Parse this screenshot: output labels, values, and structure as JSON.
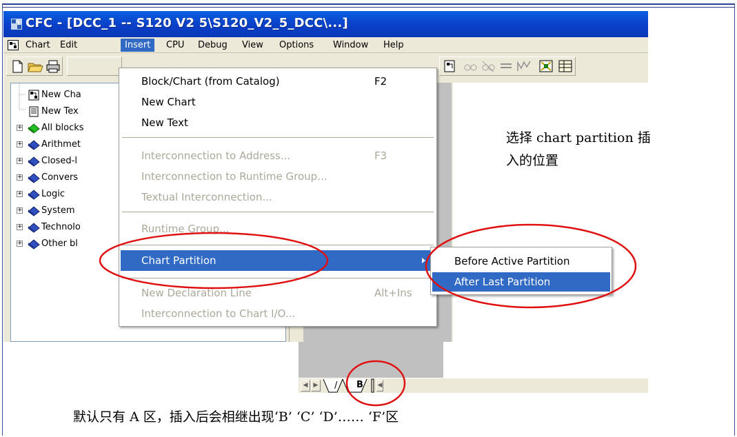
{
  "window": {
    "title": "CFC - [DCC_1 -- S120 V2 5\\S120_V2_5_DCC\\...]"
  },
  "menubar": {
    "items": [
      "Chart",
      "Edit",
      "Insert",
      "CPU",
      "Debug",
      "View",
      "Options",
      "Window",
      "Help"
    ],
    "active": "Insert"
  },
  "tree": {
    "items": [
      {
        "label": "New Cha",
        "icon": "chart-icon",
        "expandable": false
      },
      {
        "label": "New Tex",
        "icon": "text-doc-icon",
        "expandable": false
      },
      {
        "label": "All blocks",
        "icon": "green-book-icon",
        "expandable": true
      },
      {
        "label": "Arithmet",
        "icon": "blue-book-icon",
        "expandable": true
      },
      {
        "label": "Closed-l",
        "icon": "blue-book-icon",
        "expandable": true
      },
      {
        "label": "Convers",
        "icon": "blue-book-icon",
        "expandable": true
      },
      {
        "label": "Logic",
        "icon": "blue-book-icon",
        "expandable": true
      },
      {
        "label": "System",
        "icon": "blue-book-icon",
        "expandable": true
      },
      {
        "label": "Technolo",
        "icon": "blue-book-icon",
        "expandable": true
      },
      {
        "label": "Other bl",
        "icon": "blue-book-icon",
        "expandable": true
      }
    ]
  },
  "insert_menu": {
    "items": [
      {
        "label": "Block/Chart (from Catalog)",
        "shortcut": "F2",
        "enabled": true
      },
      {
        "label": "New Chart",
        "shortcut": "",
        "enabled": true
      },
      {
        "label": "New Text",
        "shortcut": "",
        "enabled": true
      },
      {
        "label": "Interconnection to Address...",
        "shortcut": "F3",
        "enabled": false
      },
      {
        "label": "Interconnection to Runtime Group...",
        "shortcut": "",
        "enabled": false
      },
      {
        "label": "Textual Interconnection...",
        "shortcut": "",
        "enabled": false
      },
      {
        "label": "Runtime Group...",
        "shortcut": "",
        "enabled": false
      },
      {
        "label": "Chart Partition",
        "shortcut": "",
        "enabled": true,
        "highlighted": true,
        "submenu": true
      },
      {
        "label": "New Declaration Line",
        "shortcut": "Alt+Ins",
        "enabled": false
      },
      {
        "label": "Interconnection to Chart I/O...",
        "shortcut": "",
        "enabled": false
      }
    ]
  },
  "submenu": {
    "items": [
      {
        "label": "Before Active Partition",
        "highlighted": false
      },
      {
        "label": "After Last Partition",
        "highlighted": true
      }
    ]
  },
  "sheet_tabs": {
    "partial": "/",
    "active": "B"
  },
  "annotations": {
    "right_line1": "选择 chart partition 插",
    "right_line2": "入的位置",
    "bottom": "默认只有 A 区，插入后会相继出现‘B’ ‘C’ ‘D’…… ‘F’区"
  },
  "colors": {
    "title_blue": "#0a3fc8",
    "highlight": "#316ac5",
    "annotation_circle": "#e01010",
    "disabled_text": "#aca899"
  }
}
